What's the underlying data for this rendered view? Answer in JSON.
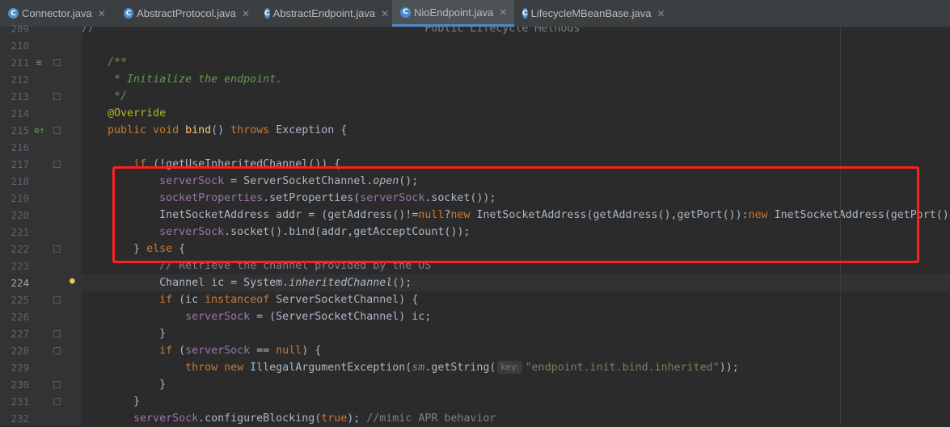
{
  "tabs": [
    {
      "label": "Connector.java",
      "active": false
    },
    {
      "label": "AbstractProtocol.java",
      "active": false
    },
    {
      "label": "AbstractEndpoint.java",
      "active": false
    },
    {
      "label": "NioEndpoint.java",
      "active": true
    },
    {
      "label": "LifecycleMBeanBase.java",
      "active": false
    }
  ],
  "tab_icon_letter": "C",
  "tab_close_glyph": "✕",
  "current_line": 224,
  "lines": [
    {
      "n": "209",
      "t": [
        [
          "cm",
          "//"
        ],
        [
          "",
          "                                                   "
        ],
        [
          "cm",
          "Public Lifecycle Methods"
        ]
      ]
    },
    {
      "n": "210",
      "t": []
    },
    {
      "n": "211",
      "t": [
        [
          "",
          "    "
        ],
        [
          "doc",
          "/**"
        ]
      ]
    },
    {
      "n": "212",
      "t": [
        [
          "",
          "     "
        ],
        [
          "doc",
          "* Initialize the endpoint."
        ]
      ]
    },
    {
      "n": "213",
      "t": [
        [
          "",
          "     "
        ],
        [
          "doc",
          "*/"
        ]
      ]
    },
    {
      "n": "214",
      "t": [
        [
          "",
          "    "
        ],
        [
          "ann",
          "@Override"
        ]
      ]
    },
    {
      "n": "215",
      "t": [
        [
          "",
          "    "
        ],
        [
          "kw",
          "public void "
        ],
        [
          "fn",
          "bind"
        ],
        [
          "",
          "() "
        ],
        [
          "kw",
          "throws "
        ],
        [
          "",
          "Exception {"
        ]
      ]
    },
    {
      "n": "216",
      "t": []
    },
    {
      "n": "217",
      "t": [
        [
          "",
          "        "
        ],
        [
          "kw",
          "if "
        ],
        [
          "",
          "(!getUseInheritedChannel()) {"
        ]
      ]
    },
    {
      "n": "218",
      "t": [
        [
          "",
          "            "
        ],
        [
          "fld",
          "serverSock"
        ],
        [
          "",
          " = ServerSocketChannel."
        ],
        [
          "it",
          "open"
        ],
        [
          "",
          "();"
        ]
      ]
    },
    {
      "n": "219",
      "t": [
        [
          "",
          "            "
        ],
        [
          "fld",
          "socketProperties"
        ],
        [
          "",
          ".setProperties("
        ],
        [
          "fld",
          "serverSock"
        ],
        [
          "",
          ".socket());"
        ]
      ]
    },
    {
      "n": "220",
      "t": [
        [
          "",
          "            InetSocketAddress addr = (getAddress()!="
        ],
        [
          "kw",
          "null"
        ],
        [
          "",
          "?"
        ],
        [
          "kw",
          "new "
        ],
        [
          "",
          "InetSocketAddress(getAddress(),getPort()):"
        ],
        [
          "kw",
          "new "
        ],
        [
          "",
          "InetSocketAddress(getPort()));"
        ]
      ]
    },
    {
      "n": "221",
      "t": [
        [
          "",
          "            "
        ],
        [
          "fld",
          "serverSock"
        ],
        [
          "",
          ".socket().bind(addr,getAcceptCount());"
        ]
      ]
    },
    {
      "n": "222",
      "t": [
        [
          "",
          "        } "
        ],
        [
          "kw",
          "else "
        ],
        [
          "",
          "{"
        ]
      ]
    },
    {
      "n": "223",
      "t": [
        [
          "",
          "            "
        ],
        [
          "cm",
          "// Retrieve the channel provided by the OS"
        ]
      ]
    },
    {
      "n": "224",
      "t": [
        [
          "",
          "            Channel ic = System."
        ],
        [
          "it",
          "inheritedChannel"
        ],
        [
          "",
          "();"
        ]
      ]
    },
    {
      "n": "225",
      "t": [
        [
          "",
          "            "
        ],
        [
          "kw",
          "if "
        ],
        [
          "",
          "(ic "
        ],
        [
          "kw",
          "instanceof "
        ],
        [
          "",
          "ServerSocketChannel) {"
        ]
      ]
    },
    {
      "n": "226",
      "t": [
        [
          "",
          "                "
        ],
        [
          "fld",
          "serverSock"
        ],
        [
          "",
          " = (ServerSocketChannel) ic;"
        ]
      ]
    },
    {
      "n": "227",
      "t": [
        [
          "",
          "            }"
        ]
      ]
    },
    {
      "n": "228",
      "t": [
        [
          "",
          "            "
        ],
        [
          "kw",
          "if "
        ],
        [
          "",
          "("
        ],
        [
          "fld",
          "serverSock"
        ],
        [
          "",
          " == "
        ],
        [
          "kw",
          "null"
        ],
        [
          "",
          ") {"
        ]
      ]
    },
    {
      "n": "229",
      "t": [
        [
          "",
          "                "
        ],
        [
          "kw",
          "throw new "
        ],
        [
          "",
          "IllegalArgumentException("
        ],
        [
          "fld it",
          "sm"
        ],
        [
          "",
          ".getString("
        ],
        [
          "hint",
          "key:"
        ],
        [
          "str",
          "\"endpoint.init.bind.inherited\""
        ],
        [
          "",
          "));"
        ]
      ]
    },
    {
      "n": "230",
      "t": [
        [
          "",
          "            }"
        ]
      ]
    },
    {
      "n": "231",
      "t": [
        [
          "",
          "        }"
        ]
      ]
    },
    {
      "n": "232",
      "t": [
        [
          "",
          "        "
        ],
        [
          "fld",
          "serverSock"
        ],
        [
          "",
          ".configureBlocking("
        ],
        [
          "kw",
          "true"
        ],
        [
          "",
          "); "
        ],
        [
          "cm",
          "//mimic APR behavior"
        ]
      ]
    }
  ]
}
